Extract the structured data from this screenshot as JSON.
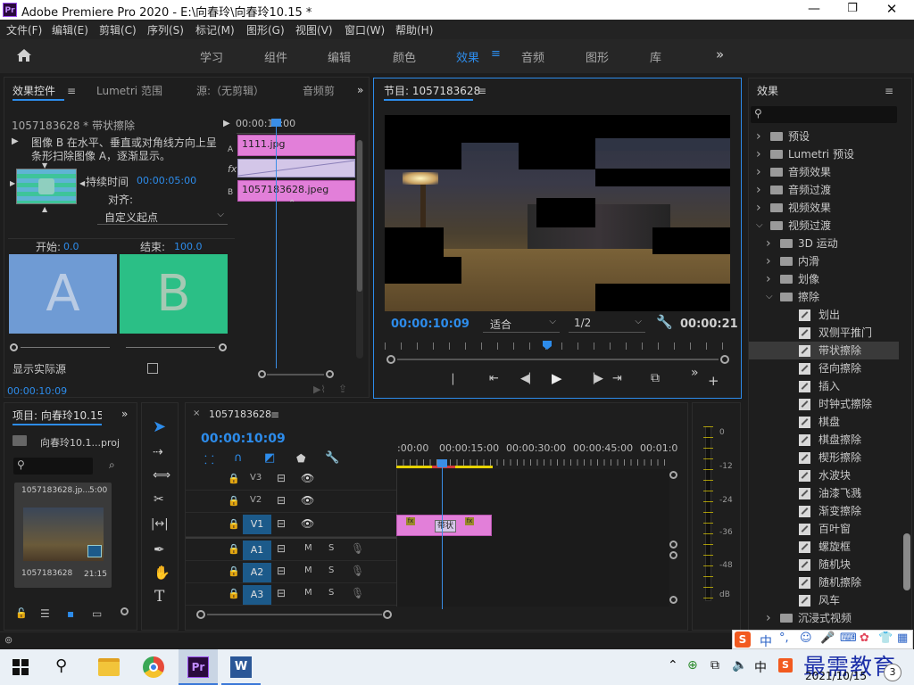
{
  "app": {
    "title": "Adobe Premiere Pro 2020 - E:\\向春玲\\向春玲10.15 *",
    "logo": "Pr"
  },
  "menu": [
    "文件(F)",
    "编辑(E)",
    "剪辑(C)",
    "序列(S)",
    "标记(M)",
    "图形(G)",
    "视图(V)",
    "窗口(W)",
    "帮助(H)"
  ],
  "workspace_tabs": [
    "学习",
    "组件",
    "编辑",
    "颜色",
    "效果",
    "音频",
    "图形",
    "库"
  ],
  "workspace_active": "效果",
  "effect_controls": {
    "tabs": [
      "效果控件",
      "Lumetri 范围",
      "源:（无剪辑）",
      "音频剪"
    ],
    "clip_name": "1057183628 * 带状擦除",
    "timecode_top": "00:00:10:00",
    "description": "图像 B 在水平、垂直或对角线方向上呈条形扫除图像 A，逐渐显示。",
    "duration_label": "持续时间",
    "duration_value": "00:00:05:00",
    "align_label": "对齐:",
    "align_value": "自定义起点",
    "start_label": "开始:",
    "start_value": "0.0",
    "end_label": "结束:",
    "end_value": "100.0",
    "a_label": "A",
    "b_label": "B",
    "show_source": "显示实际源",
    "clip_a": "1111.jpg",
    "clip_b": "1057183628.jpeg",
    "track_a": "A",
    "track_b": "B",
    "fx": "fx",
    "timecode_bottom": "00:00:10:09"
  },
  "program": {
    "title": "节目: 1057183628",
    "timecode": "00:00:10:09",
    "fit": "适合",
    "resolution": "1/2",
    "duration": "00:00:21"
  },
  "effects_panel": {
    "title": "效果",
    "tree": [
      {
        "label": "预设",
        "level": 0,
        "type": "folder",
        "expanded": false
      },
      {
        "label": "Lumetri 预设",
        "level": 0,
        "type": "folder",
        "expanded": false
      },
      {
        "label": "音频效果",
        "level": 0,
        "type": "folder",
        "expanded": false
      },
      {
        "label": "音频过渡",
        "level": 0,
        "type": "folder",
        "expanded": false
      },
      {
        "label": "视频效果",
        "level": 0,
        "type": "folder",
        "expanded": false
      },
      {
        "label": "视频过渡",
        "level": 0,
        "type": "folder",
        "expanded": true
      },
      {
        "label": "3D 运动",
        "level": 1,
        "type": "folder",
        "expanded": false
      },
      {
        "label": "内滑",
        "level": 1,
        "type": "folder",
        "expanded": false
      },
      {
        "label": "划像",
        "level": 1,
        "type": "folder",
        "expanded": false
      },
      {
        "label": "擦除",
        "level": 1,
        "type": "folder",
        "expanded": true
      },
      {
        "label": "划出",
        "level": 2,
        "type": "preset"
      },
      {
        "label": "双侧平推门",
        "level": 2,
        "type": "preset"
      },
      {
        "label": "带状擦除",
        "level": 2,
        "type": "preset",
        "selected": true
      },
      {
        "label": "径向擦除",
        "level": 2,
        "type": "preset"
      },
      {
        "label": "插入",
        "level": 2,
        "type": "preset"
      },
      {
        "label": "时钟式擦除",
        "level": 2,
        "type": "preset"
      },
      {
        "label": "棋盘",
        "level": 2,
        "type": "preset"
      },
      {
        "label": "棋盘擦除",
        "level": 2,
        "type": "preset"
      },
      {
        "label": "楔形擦除",
        "level": 2,
        "type": "preset"
      },
      {
        "label": "水波块",
        "level": 2,
        "type": "preset"
      },
      {
        "label": "油漆飞溅",
        "level": 2,
        "type": "preset"
      },
      {
        "label": "渐变擦除",
        "level": 2,
        "type": "preset"
      },
      {
        "label": "百叶窗",
        "level": 2,
        "type": "preset"
      },
      {
        "label": "螺旋框",
        "level": 2,
        "type": "preset"
      },
      {
        "label": "随机块",
        "level": 2,
        "type": "preset"
      },
      {
        "label": "随机擦除",
        "level": 2,
        "type": "preset"
      },
      {
        "label": "风车",
        "level": 2,
        "type": "preset"
      },
      {
        "label": "沉浸式视频",
        "level": 1,
        "type": "folder",
        "expanded": false
      }
    ]
  },
  "project": {
    "title": "项目: 向春玲10.15",
    "file": "向春玲10.1...proj",
    "clip_name": "1057183628.jp...",
    "clip_dur": "5:00",
    "thumb_name": "1057183628",
    "thumb_dur": "21:15"
  },
  "timeline": {
    "title": "1057183628",
    "timecode": "00:00:10:09",
    "ruler": [
      ":00:00",
      "00:00:15:00",
      "00:00:30:00",
      "00:00:45:00",
      "00:01:0"
    ],
    "tracks": [
      "V3",
      "V2",
      "V1",
      "A1",
      "A2",
      "A3"
    ],
    "m_label": "M",
    "s_label": "S",
    "transition_label": "带状",
    "fx": "fx"
  },
  "meter": {
    "scale": [
      "0",
      "-12",
      "-24",
      "-36",
      "-48",
      "dB"
    ]
  },
  "taskbar": {
    "date": "2021/10/15",
    "ime": "中",
    "watermark": "最需教育"
  },
  "colors": {
    "accent": "#2d8ceb",
    "clip_pink": "#e27fd9",
    "a_block": "#6f9bd4",
    "b_block": "#2bbf86"
  }
}
